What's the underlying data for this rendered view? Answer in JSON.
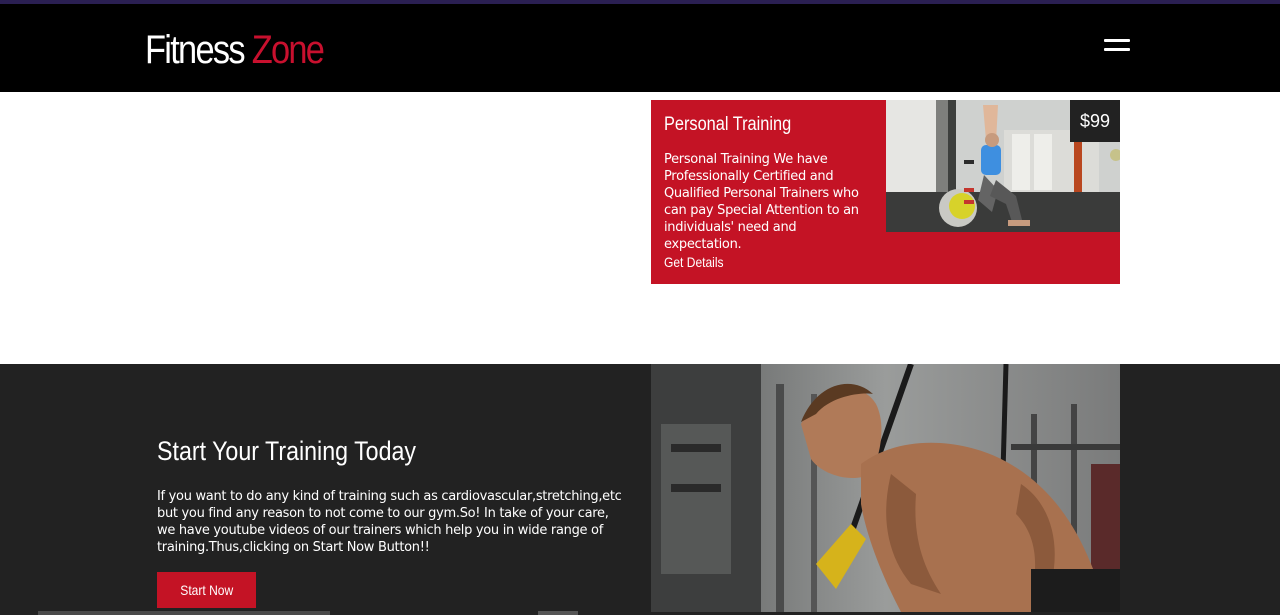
{
  "header": {
    "brand_main": "Fitness",
    "brand_accent": "Zone"
  },
  "pricing_card": {
    "title": "Personal Training",
    "description": "Personal Training We have Professionally Certified and Qualified Personal Trainers who can pay Special Attention to an individuals' need and expectation.",
    "link_label": "Get Details",
    "price": "$99"
  },
  "cta_section": {
    "title": "Start Your Training Today",
    "text": "If you want to do any kind of training such as cardiovascular,stretching,etc but you find any reason to not come to our gym.So! In take of your care, we have youtube videos of our trainers which help you in wide range of training.Thus,clicking on Start Now Button!!",
    "button_label": "Start Now"
  },
  "colors": {
    "brand_red": "#c41325",
    "dark_bg": "#222222",
    "navbar_bg": "#000000"
  },
  "icons": {
    "menu": "hamburger-menu-icon"
  }
}
